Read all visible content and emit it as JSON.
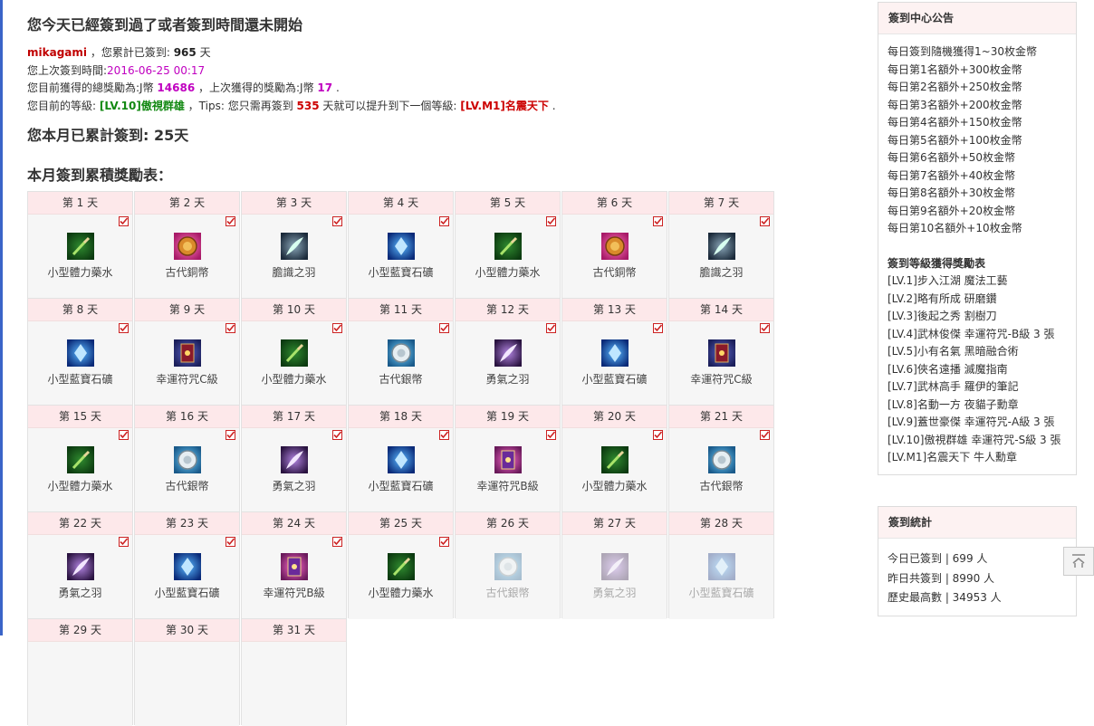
{
  "page": {
    "title": "您今天已經簽到過了或者簽到時間還未開始",
    "month_total": "您本月已累計簽到: 25天",
    "reward_table_title": "本月簽到累積獎勵表："
  },
  "info": {
    "username": "mikagami",
    "t1": "，您累計已簽到:",
    "total_days": "965",
    "t2": "天",
    "t3": "您上次簽到時間:",
    "last_time": "2016-06-25 00:17",
    "t4": "您目前獲得的總獎勵為:J幣",
    "total_reward": "14686",
    "t5": "，上次獲得的獎勵為:J幣",
    "last_reward": "17",
    "t6": ".",
    "t7": "您目前的等級:",
    "level": "[LV.10]傲視群雄",
    "t8": "，Tips: 您只需再簽到",
    "days_needed": "535",
    "t9": "天就可以提升到下一個等級:",
    "next_level": "[LV.M1]名震天下",
    "t10": "."
  },
  "calendar": [
    {
      "day": "第 1 天",
      "item": "小型體力藥水",
      "icon": "potion-icon",
      "done": true
    },
    {
      "day": "第 2 天",
      "item": "古代銅幣",
      "icon": "bronze-coin-icon",
      "done": true
    },
    {
      "day": "第 3 天",
      "item": "膽識之羽",
      "icon": "courage-feather-icon",
      "done": true
    },
    {
      "day": "第 4 天",
      "item": "小型藍寶石礦",
      "icon": "sapphire-icon",
      "done": true
    },
    {
      "day": "第 5 天",
      "item": "小型體力藥水",
      "icon": "potion-icon",
      "done": true
    },
    {
      "day": "第 6 天",
      "item": "古代銅幣",
      "icon": "bronze-coin-icon",
      "done": true
    },
    {
      "day": "第 7 天",
      "item": "膽識之羽",
      "icon": "courage-feather-icon",
      "done": true
    },
    {
      "day": "第 8 天",
      "item": "小型藍寶石礦",
      "icon": "sapphire-icon",
      "done": true
    },
    {
      "day": "第 9 天",
      "item": "幸運符咒C級",
      "icon": "luck-charm-c-icon",
      "done": true
    },
    {
      "day": "第 10 天",
      "item": "小型體力藥水",
      "icon": "potion-icon",
      "done": true
    },
    {
      "day": "第 11 天",
      "item": "古代銀幣",
      "icon": "silver-coin-icon",
      "done": true
    },
    {
      "day": "第 12 天",
      "item": "勇氣之羽",
      "icon": "brave-feather-icon",
      "done": true
    },
    {
      "day": "第 13 天",
      "item": "小型藍寶石礦",
      "icon": "sapphire-icon",
      "done": true
    },
    {
      "day": "第 14 天",
      "item": "幸運符咒C級",
      "icon": "luck-charm-c-icon",
      "done": true
    },
    {
      "day": "第 15 天",
      "item": "小型體力藥水",
      "icon": "potion-icon",
      "done": true
    },
    {
      "day": "第 16 天",
      "item": "古代銀幣",
      "icon": "silver-coin-icon",
      "done": true
    },
    {
      "day": "第 17 天",
      "item": "勇氣之羽",
      "icon": "brave-feather-icon",
      "done": true
    },
    {
      "day": "第 18 天",
      "item": "小型藍寶石礦",
      "icon": "sapphire-icon",
      "done": true
    },
    {
      "day": "第 19 天",
      "item": "幸運符咒B級",
      "icon": "luck-charm-b-icon",
      "done": true
    },
    {
      "day": "第 20 天",
      "item": "小型體力藥水",
      "icon": "potion-icon",
      "done": true
    },
    {
      "day": "第 21 天",
      "item": "古代銀幣",
      "icon": "silver-coin-icon",
      "done": true
    },
    {
      "day": "第 22 天",
      "item": "勇氣之羽",
      "icon": "brave-feather-icon",
      "done": true
    },
    {
      "day": "第 23 天",
      "item": "小型藍寶石礦",
      "icon": "sapphire-icon",
      "done": true
    },
    {
      "day": "第 24 天",
      "item": "幸運符咒B級",
      "icon": "luck-charm-b-icon",
      "done": true
    },
    {
      "day": "第 25 天",
      "item": "小型體力藥水",
      "icon": "potion-icon",
      "done": true
    },
    {
      "day": "第 26 天",
      "item": "古代銀幣",
      "icon": "silver-coin-icon",
      "done": false
    },
    {
      "day": "第 27 天",
      "item": "勇氣之羽",
      "icon": "brave-feather-icon",
      "done": false
    },
    {
      "day": "第 28 天",
      "item": "小型藍寶石礦",
      "icon": "sapphire-icon",
      "done": false
    },
    {
      "day": "第 29 天",
      "item": "",
      "icon": "",
      "done": false
    },
    {
      "day": "第 30 天",
      "item": "",
      "icon": "",
      "done": false
    },
    {
      "day": "第 31 天",
      "item": "",
      "icon": "",
      "done": false
    }
  ],
  "sidebar": {
    "notice_title": "簽到中心公告",
    "notices": [
      "每日簽到隨機獲得1~30枚金幣",
      "每日第1名額外+300枚金幣",
      "每日第2名額外+250枚金幣",
      "每日第3名額外+200枚金幣",
      "每日第4名額外+150枚金幣",
      "每日第5名額外+100枚金幣",
      "每日第6名額外+50枚金幣",
      "每日第7名額外+40枚金幣",
      "每日第8名額外+30枚金幣",
      "每日第9名額外+20枚金幣",
      "每日第10名額外+10枚金幣"
    ],
    "level_title": "簽到等級獲得獎勵表",
    "levels": [
      "[LV.1]步入江湖 魔法工藝",
      "[LV.2]略有所成 研磨鑽",
      "[LV.3]後起之秀 割樹刀",
      "[LV.4]武林俊傑 幸運符咒-B級 3 張",
      "[LV.5]小有名氣 黑暗融合術",
      "[LV.6]俠名遠播 滅魔指南",
      "[LV.7]武林高手 羅伊的筆記",
      "[LV.8]名動一方 夜貓子勳章",
      "[LV.9]蓋世豪傑 幸運符咒-A級 3 張",
      "[LV.10]傲視群雄 幸運符咒-S級 3 張",
      "[LV.M1]名震天下 牛人勳章"
    ],
    "stats_title": "簽到統計",
    "stats": [
      "今日已簽到 | 699 人",
      "昨日共簽到 | 8990 人",
      "歷史最高數 | 34953 人"
    ]
  },
  "colors": {
    "accent_red": "#c00000",
    "magenta": "#c000c0",
    "green": "#118811",
    "header_pink": "#fde8ea"
  }
}
